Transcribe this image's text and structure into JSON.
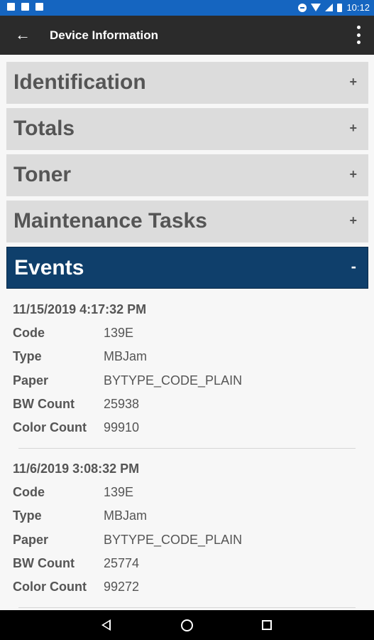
{
  "status_bar": {
    "time": "10:12",
    "icons": [
      "gmail-icon",
      "image-icon",
      "dnd-icon",
      "wifi-icon",
      "signal-icon",
      "battery-icon"
    ]
  },
  "app_bar": {
    "title": "Device Information",
    "back_icon": "arrow-left-icon",
    "menu_icon": "more-vert-icon",
    "back_glyph": "←"
  },
  "sections": [
    {
      "label": "Identification",
      "toggle": "+",
      "expanded": false
    },
    {
      "label": "Totals",
      "toggle": "+",
      "expanded": false
    },
    {
      "label": "Toner",
      "toggle": "+",
      "expanded": false
    },
    {
      "label": "Maintenance Tasks",
      "toggle": "+",
      "expanded": false
    },
    {
      "label": "Events",
      "toggle": "-",
      "expanded": true
    }
  ],
  "event_fields": {
    "code": "Code",
    "type": "Type",
    "paper": "Paper",
    "bw_count": "BW Count",
    "color_count": "Color Count"
  },
  "events": [
    {
      "date": "11/15/2019 4:17:32 PM",
      "code": "139E",
      "type": "MBJam",
      "paper": "BYTYPE_CODE_PLAIN",
      "bw_count": "25938",
      "color_count": "99910"
    },
    {
      "date": "11/6/2019 3:08:32 PM",
      "code": "139E",
      "type": "MBJam",
      "paper": "BYTYPE_CODE_PLAIN",
      "bw_count": "25774",
      "color_count": "99272"
    }
  ],
  "colors": {
    "status_bar": "#1565c0",
    "app_bar": "#2b2b2b",
    "section_bg": "#dcdcdc",
    "section_active": "#0f3f6b"
  }
}
